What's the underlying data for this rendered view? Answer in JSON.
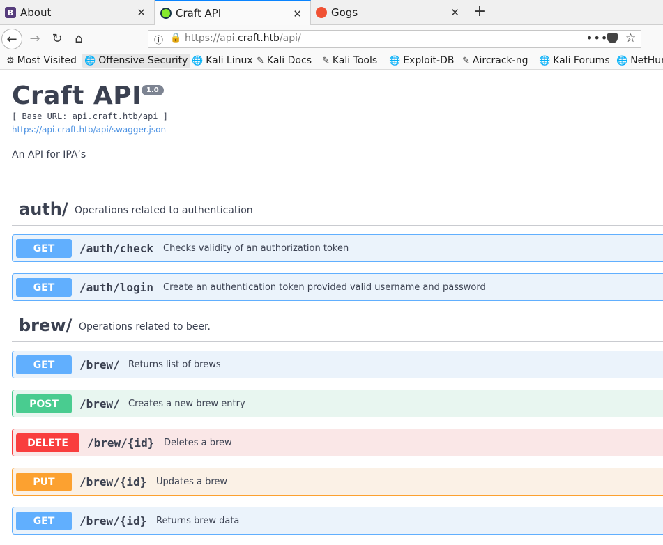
{
  "tabs": [
    {
      "label": "About",
      "icon_letter": "B",
      "icon_color": "#563d7c"
    },
    {
      "label": "Craft API",
      "icon_color": "#85ea2d"
    },
    {
      "label": "Gogs",
      "icon_color": "#f05133"
    }
  ],
  "tab_close": "✕",
  "new_tab": "+",
  "nav": {
    "back": "←",
    "forward": "→",
    "reload": "↻",
    "home": "⌂"
  },
  "url": {
    "prefix": "https://api.",
    "domain": "craft.htb",
    "suffix": "/api/",
    "info_icon": "ⓘ",
    "more": "•••",
    "star": "☆"
  },
  "bookmarks": [
    {
      "label": "Most Visited",
      "icon": "⚙"
    },
    {
      "label": "Offensive Security",
      "icon": "🌐"
    },
    {
      "label": "Kali Linux",
      "icon": "🌐"
    },
    {
      "label": "Kali Docs",
      "icon": "✎"
    },
    {
      "label": "Kali Tools",
      "icon": "✎"
    },
    {
      "label": "Exploit-DB",
      "icon": "🌐"
    },
    {
      "label": "Aircrack-ng",
      "icon": "✎"
    },
    {
      "label": "Kali Forums",
      "icon": "🌐"
    },
    {
      "label": "NetHunter",
      "icon": "🌐"
    }
  ],
  "api": {
    "title": "Craft API",
    "version": "1.0",
    "base_url": "[ Base URL: api.craft.htb/api ]",
    "swagger_link": "https://api.craft.htb/api/swagger.json",
    "description": "An API for IPA’s"
  },
  "tags": [
    {
      "name": "auth/",
      "description": "Operations related to authentication",
      "operations": [
        {
          "method": "GET",
          "path": "/auth/check",
          "summary": "Checks validity of an authorization token"
        },
        {
          "method": "GET",
          "path": "/auth/login",
          "summary": "Create an authentication token provided valid username and password"
        }
      ]
    },
    {
      "name": "brew/",
      "description": "Operations related to beer.",
      "operations": [
        {
          "method": "GET",
          "path": "/brew/",
          "summary": "Returns list of brews"
        },
        {
          "method": "POST",
          "path": "/brew/",
          "summary": "Creates a new brew entry"
        },
        {
          "method": "DELETE",
          "path": "/brew/{id}",
          "summary": "Deletes a brew"
        },
        {
          "method": "PUT",
          "path": "/brew/{id}",
          "summary": "Updates a brew"
        },
        {
          "method": "GET",
          "path": "/brew/{id}",
          "summary": "Returns brew data"
        }
      ]
    }
  ]
}
